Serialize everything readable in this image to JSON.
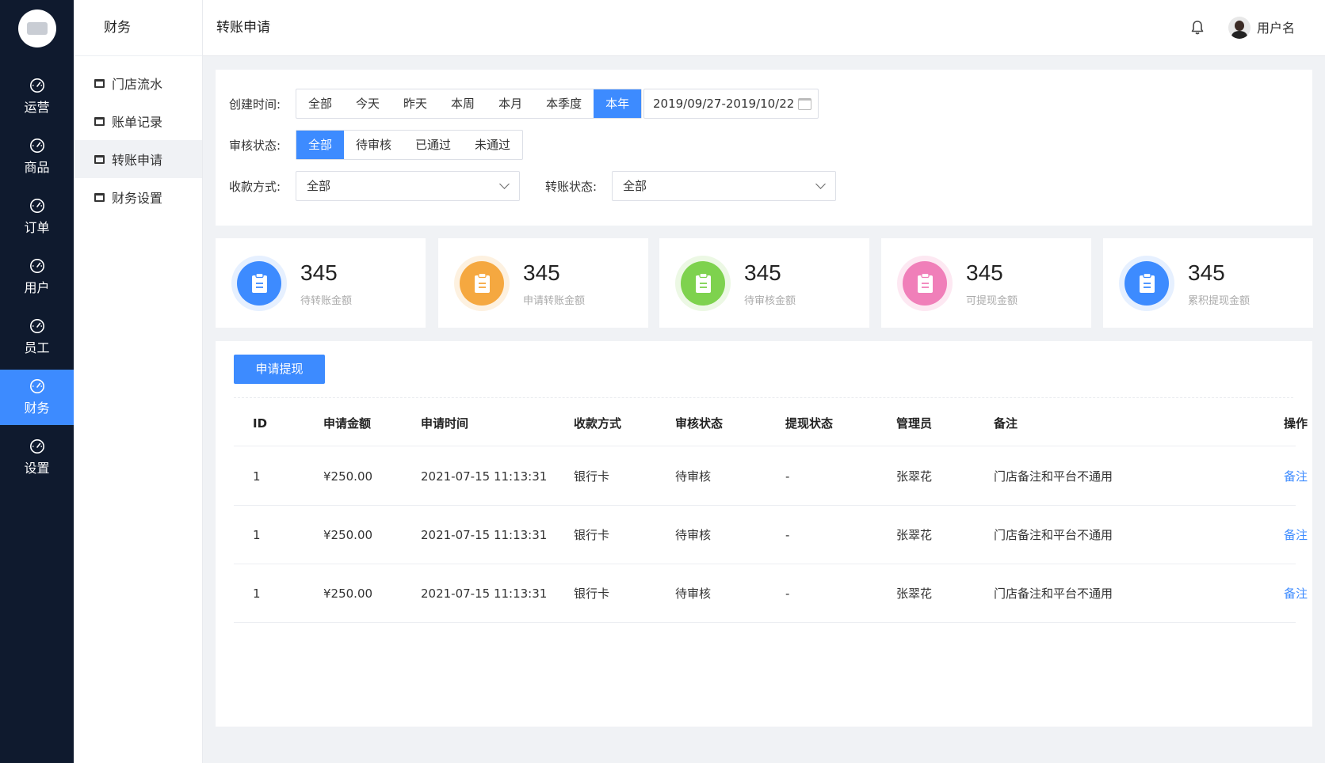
{
  "nav": {
    "items": [
      {
        "label": "运营",
        "icon": "gauge-icon"
      },
      {
        "label": "商品",
        "icon": "gauge-icon"
      },
      {
        "label": "订单",
        "icon": "gauge-icon"
      },
      {
        "label": "用户",
        "icon": "gauge-icon"
      },
      {
        "label": "员工",
        "icon": "gauge-icon"
      },
      {
        "label": "财务",
        "icon": "gauge-icon",
        "active": true
      },
      {
        "label": "设置",
        "icon": "gauge-icon"
      }
    ]
  },
  "subnav": {
    "title": "财务",
    "items": [
      {
        "label": "门店流水"
      },
      {
        "label": "账单记录"
      },
      {
        "label": "转账申请",
        "active": true
      },
      {
        "label": "财务设置"
      }
    ]
  },
  "header": {
    "title": "转账申请",
    "username": "用户名"
  },
  "filters": {
    "created_time_label": "创建时间:",
    "time_options": [
      "全部",
      "今天",
      "昨天",
      "本周",
      "本月",
      "本季度",
      "本年"
    ],
    "time_selected": "本年",
    "date_range": "2019/09/27-2019/10/22",
    "review_status_label": "审核状态:",
    "review_options": [
      "全部",
      "待审核",
      "已通过",
      "未通过"
    ],
    "review_selected": "全部",
    "payment_method_label": "收款方式:",
    "payment_method_value": "全部",
    "transfer_status_label": "转账状态:",
    "transfer_status_value": "全部"
  },
  "stats": [
    {
      "value": "345",
      "label": "待转账金额",
      "color": "#3d8bff",
      "ring": "#e6f0ff"
    },
    {
      "value": "345",
      "label": "申请转账金额",
      "color": "#f5a840",
      "ring": "#fdf1e0"
    },
    {
      "value": "345",
      "label": "待审核金额",
      "color": "#7ed24e",
      "ring": "#ecf8e4"
    },
    {
      "value": "345",
      "label": "可提现金额",
      "color": "#f07fb9",
      "ring": "#fde8f2"
    },
    {
      "value": "345",
      "label": "累积提现金额",
      "color": "#3d8bff",
      "ring": "#e6f0ff"
    }
  ],
  "table": {
    "apply_button": "申请提现",
    "columns": [
      "ID",
      "申请金额",
      "申请时间",
      "收款方式",
      "审核状态",
      "提现状态",
      "管理员",
      "备注",
      "操作"
    ],
    "rows": [
      [
        "1",
        "¥250.00",
        "2021-07-15 11:13:31",
        "银行卡",
        "待审核",
        "-",
        "张翠花",
        "门店备注和平台不通用",
        "备注"
      ],
      [
        "1",
        "¥250.00",
        "2021-07-15 11:13:31",
        "银行卡",
        "待审核",
        "-",
        "张翠花",
        "门店备注和平台不通用",
        "备注"
      ],
      [
        "1",
        "¥250.00",
        "2021-07-15 11:13:31",
        "银行卡",
        "待审核",
        "-",
        "张翠花",
        "门店备注和平台不通用",
        "备注"
      ]
    ]
  },
  "colors": {
    "accent": "#3d8bff",
    "nav_bg": "#0f1a2e"
  }
}
